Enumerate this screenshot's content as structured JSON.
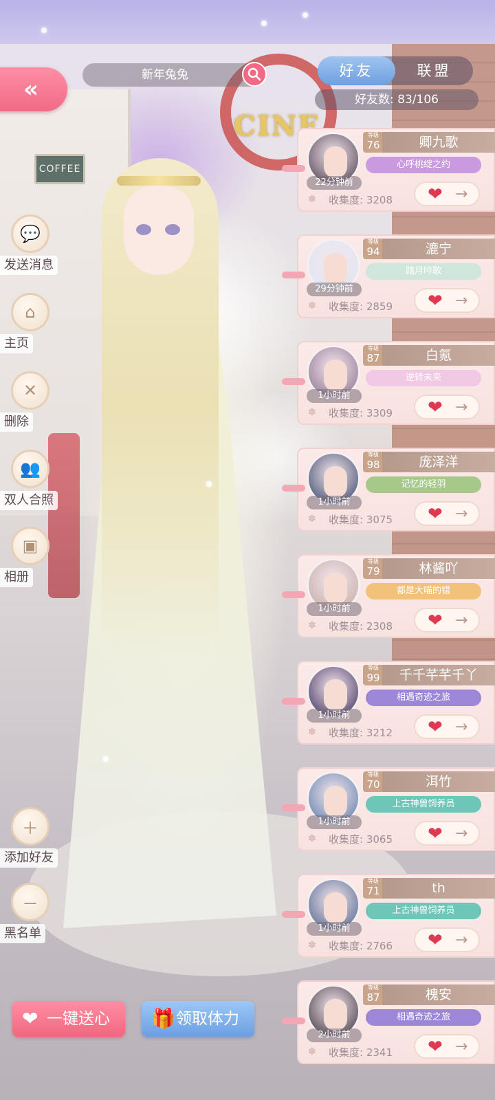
{
  "search": {
    "text": "新年兔兔"
  },
  "tabs": [
    {
      "label": "好友",
      "active": true
    },
    {
      "label": "联盟",
      "active": false
    }
  ],
  "friend_count": {
    "text": "好友数: 83/106"
  },
  "scene": {
    "sign_text": "COFFEE",
    "marquee_text": "CINE"
  },
  "side_actions": [
    {
      "label": "发送消息",
      "icon": "chat-bubble-icon"
    },
    {
      "label": "主页",
      "icon": "home-icon"
    },
    {
      "label": "删除",
      "icon": "delete-x-icon"
    },
    {
      "label": "双人合照",
      "icon": "couple-photo-icon"
    },
    {
      "label": "相册",
      "icon": "album-icon"
    },
    {
      "label": "添加好友",
      "icon": "add-icon"
    },
    {
      "label": "黑名单",
      "icon": "blacklist-minus-icon"
    }
  ],
  "level_tag": "等级",
  "collection_prefix": "收集度:",
  "friends": [
    {
      "name": "卿九歌",
      "level": "76",
      "time": "22分钟前",
      "title": "心呼桃绽之约",
      "title_color": "#c99adf",
      "collection": "3208"
    },
    {
      "name": "漉宁",
      "level": "94",
      "time": "29分钟前",
      "title": "踏月吟歌",
      "title_color": "#cfe6dc",
      "collection": "2859"
    },
    {
      "name": "白氪",
      "level": "87",
      "time": "1小时前",
      "title": "逆转未来",
      "title_color": "#f2c9e4",
      "collection": "3309"
    },
    {
      "name": "庞泽洋",
      "level": "98",
      "time": "1小时前",
      "title": "记忆的轻羽",
      "title_color": "#a6c98a",
      "collection": "3075"
    },
    {
      "name": "林酱吖",
      "level": "79",
      "time": "1小时前",
      "title": "都是大喵的错",
      "title_color": "#f3c27a",
      "collection": "2308"
    },
    {
      "name": "千千芊芊千丫",
      "level": "99",
      "time": "1小时前",
      "title": "相遇奇迹之旅",
      "title_color": "#9b86d8",
      "collection": "3212"
    },
    {
      "name": "洱竹",
      "level": "70",
      "time": "1小时前",
      "title": "上古神兽饲养员",
      "title_color": "#6ec6b8",
      "collection": "3065"
    },
    {
      "name": "th",
      "level": "71",
      "time": "1小时前",
      "title": "上古神兽饲养员",
      "title_color": "#6ec6b8",
      "collection": "2766"
    },
    {
      "name": "槐安",
      "level": "87",
      "time": "2小时前",
      "title": "相遇奇迹之旅",
      "title_color": "#9b86d8",
      "collection": "2341"
    }
  ],
  "bottom": {
    "send_all_label": "一键送心",
    "claim_label": "领取体力"
  },
  "colors": {
    "pink_accent": "#f06a86",
    "blue_accent": "#6f9fe0",
    "heart": "#e03850"
  }
}
